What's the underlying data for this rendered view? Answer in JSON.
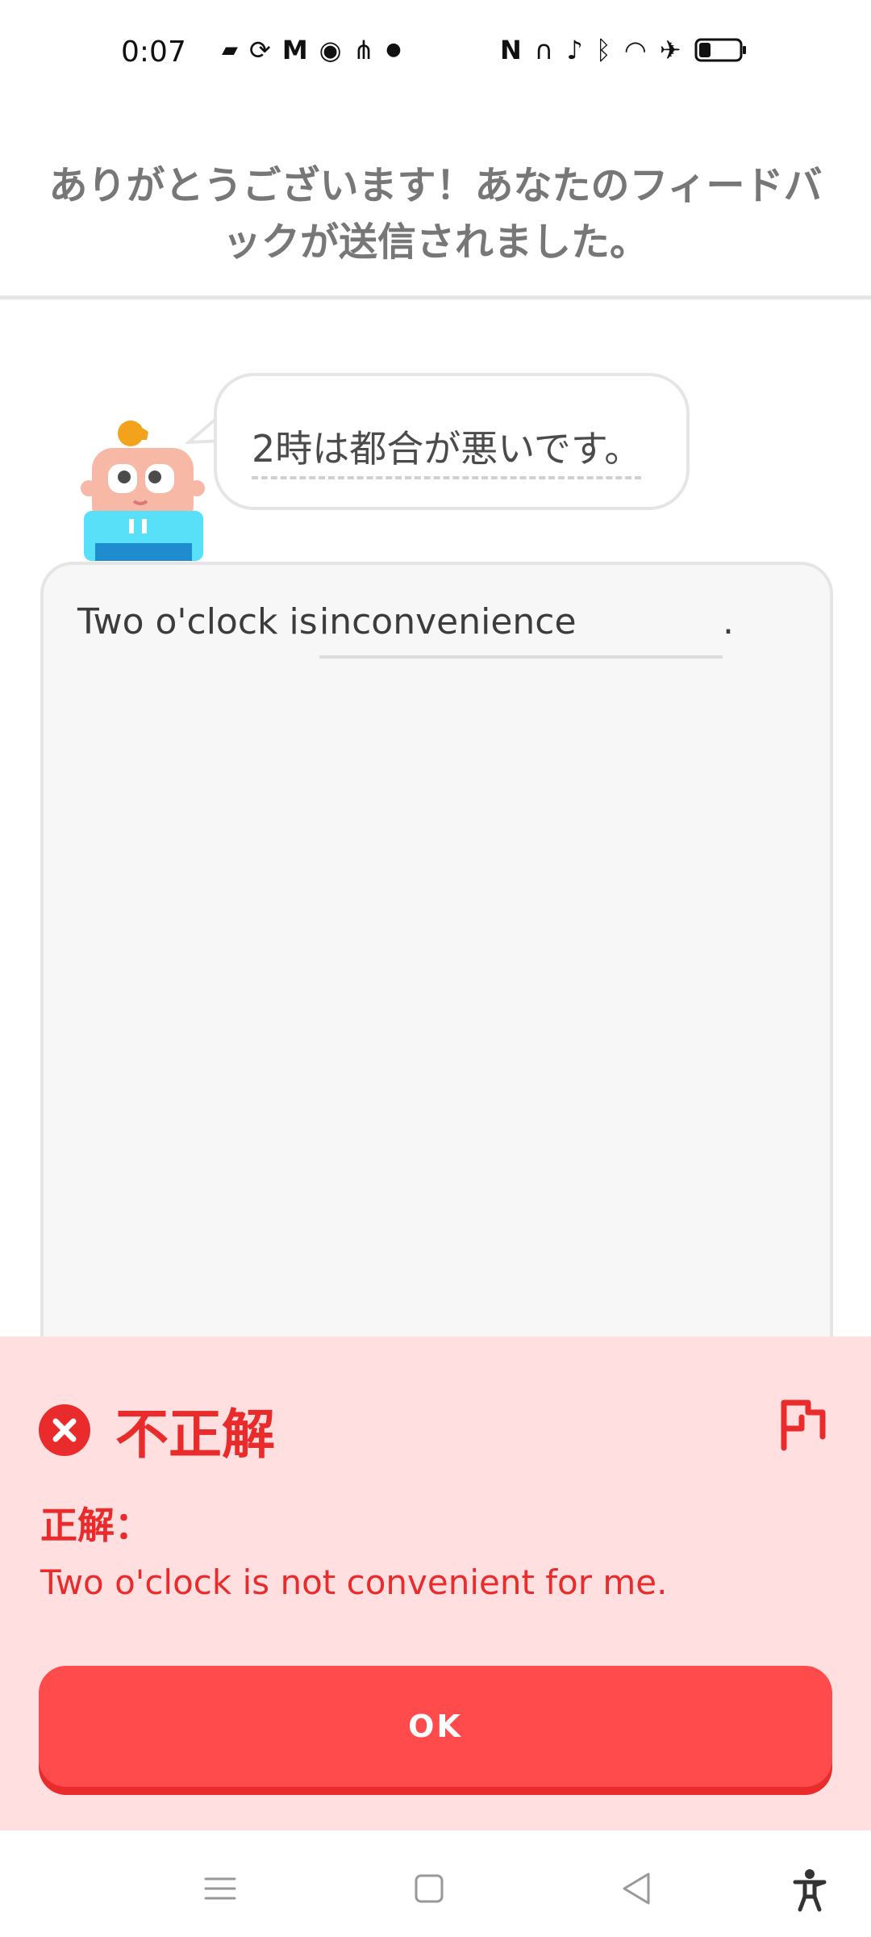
{
  "status_bar": {
    "time": "0:07"
  },
  "banner": {
    "message": "ありがとうございます！あなたのフィードバックが送信されました。"
  },
  "prompt": {
    "japanese_sentence": "2時は都合が悪いです。"
  },
  "answer": {
    "prefix": "Two o'clock is",
    "typed_text": "inconvenience",
    "suffix": "."
  },
  "feedback": {
    "status": "不正解",
    "correct_label": "正解：",
    "correct_answer": "Two o'clock is not convenient for me.",
    "button_label": "OK"
  },
  "colors": {
    "error_red": "#ea2b2b",
    "button_red": "#ff4b4b",
    "feedback_bg": "#ffdfe0"
  }
}
